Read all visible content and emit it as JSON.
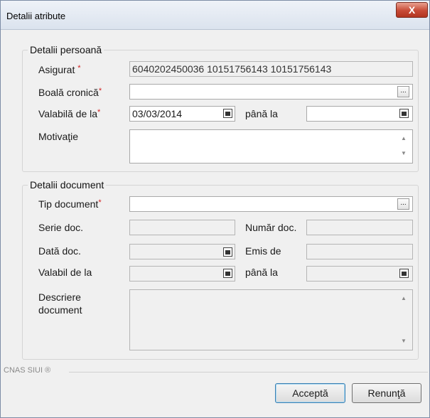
{
  "window": {
    "title": "Detalii atribute",
    "close_label": "X"
  },
  "person": {
    "group_title": "Detalii persoană",
    "asigurat_label": "Asigurat",
    "asigurat_value": "6040202450036 10151756143 10151756143",
    "boala_label": "Boală cronică",
    "boala_value": "",
    "valabila_label": "Valabilă de la",
    "valabila_value": "03/03/2014",
    "pana_label": "până la",
    "pana_value": "",
    "motivatie_label": "Motivaţie",
    "motivatie_value": "",
    "required_mark": "*"
  },
  "document": {
    "group_title": "Detalii document",
    "tip_label": "Tip document",
    "tip_value": "",
    "serie_label": "Serie doc.",
    "serie_value": "",
    "numar_label": "Număr doc.",
    "numar_value": "",
    "data_label": "Dată doc.",
    "data_value": "",
    "emis_label": "Emis de",
    "emis_value": "",
    "valabil_label": "Valabil de la",
    "valabil_value": "",
    "pana_label": "până la",
    "pana_value": "",
    "descriere_label_1": "Descriere",
    "descriere_label_2": "document",
    "descriere_value": ""
  },
  "footer": {
    "brand": "CNAS SIUI ®"
  },
  "buttons": {
    "accept": "Acceptă",
    "cancel": "Renunţă"
  },
  "icons": {
    "ellipsis": "...",
    "scroll_up": "▲",
    "scroll_down": "▼"
  }
}
